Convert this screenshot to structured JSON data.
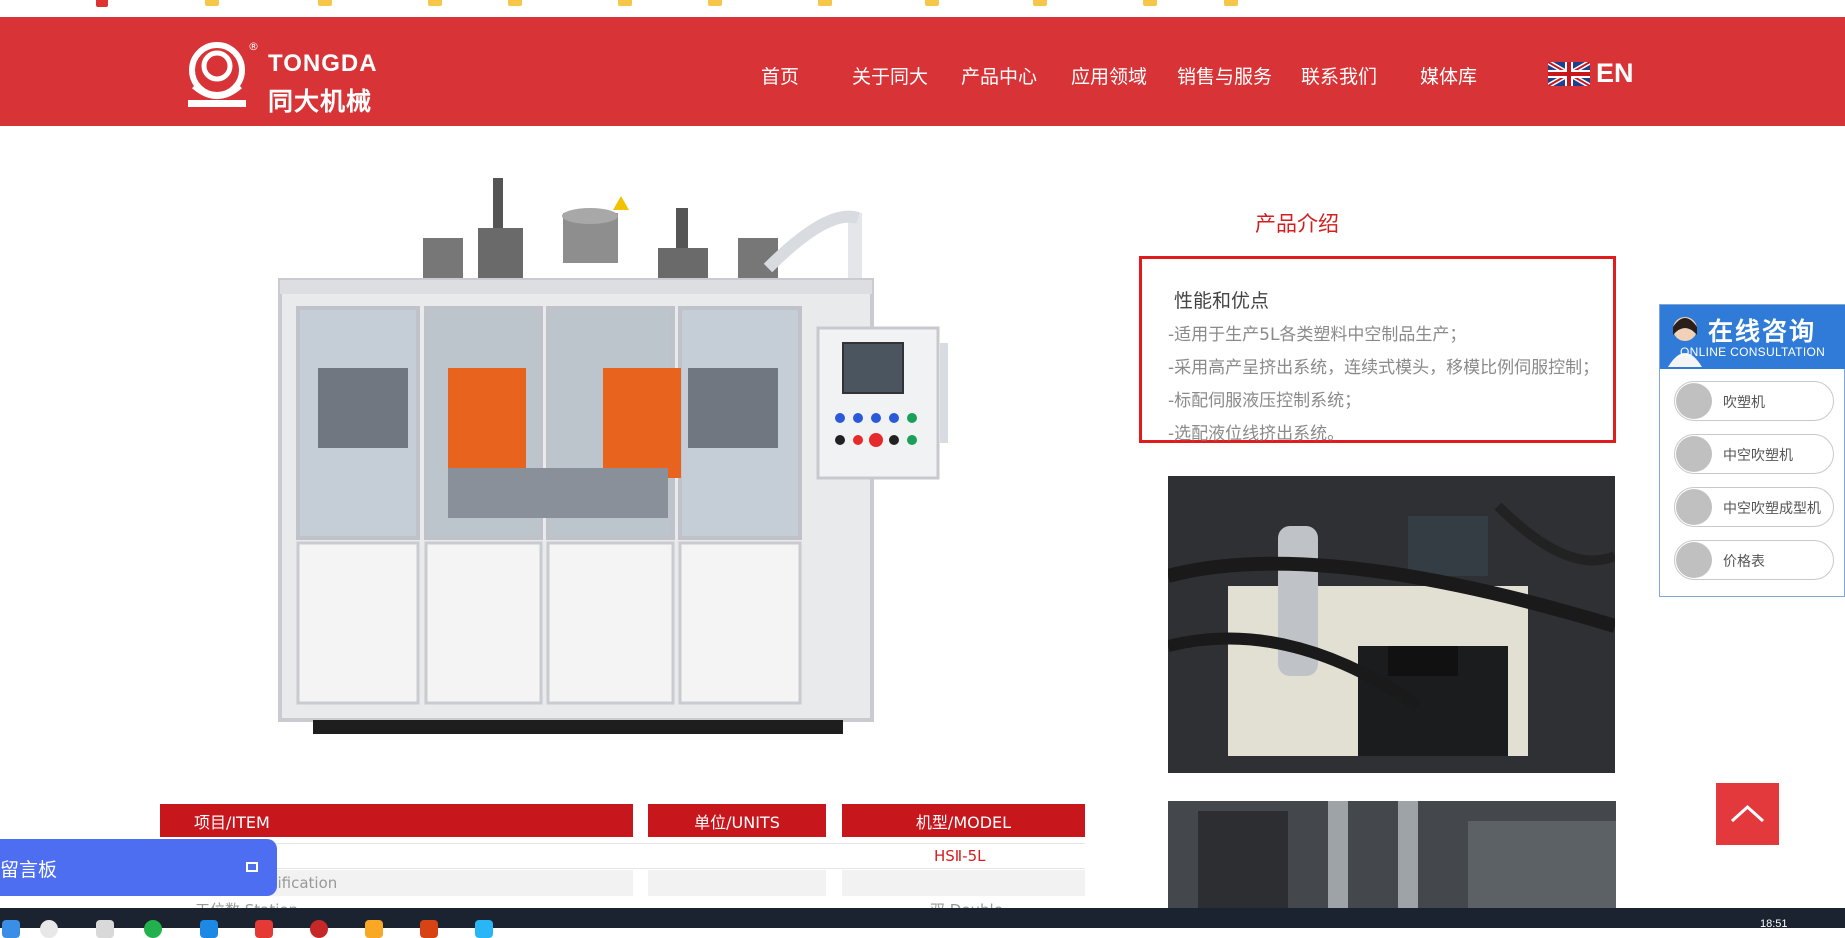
{
  "bookmarks": [
    {
      "label": "",
      "icon": "red-star-icon"
    },
    {
      "label": "",
      "icon": "folder-icon"
    },
    {
      "label": "",
      "icon": "folder-icon"
    },
    {
      "label": "",
      "icon": "folder-icon"
    },
    {
      "label": "",
      "icon": "folder-icon"
    },
    {
      "label": "",
      "icon": "folder-icon"
    },
    {
      "label": "",
      "icon": "folder-icon"
    },
    {
      "label": "",
      "icon": "folder-icon"
    },
    {
      "label": "",
      "icon": "folder-icon"
    },
    {
      "label": "",
      "icon": "folder-icon"
    },
    {
      "label": "",
      "icon": "folder-icon"
    },
    {
      "label": "",
      "icon": "folder-icon"
    }
  ],
  "header": {
    "brand_en": "TONGDA",
    "brand_cn": "同大机械",
    "reg_mark": "®",
    "nav": [
      "首页",
      "关于同大",
      "产品中心",
      "应用领域",
      "销售与服务",
      "联系我们",
      "媒体库"
    ],
    "lang": "EN",
    "colors": {
      "header_bg": "#d83336"
    }
  },
  "intro": {
    "title": "产品介绍",
    "heading": "性能和优点",
    "lines": [
      "-适用于生产5L各类塑料中空制品生产；",
      "-采用高产呈挤出系统，连续式模头，移模比例伺服控制；",
      "-标配伺服液压控制系统；",
      "-选配液位线挤出系统。"
    ]
  },
  "spec_table": {
    "headers": [
      "项目/ITEM",
      "单位/UNITS",
      "机型/MODEL"
    ],
    "rows": [
      [
        "",
        "",
        "HSⅡ-5L"
      ],
      [
        "ecification",
        "",
        ""
      ],
      [
        "工位数 Station",
        "",
        "双 Double"
      ]
    ]
  },
  "consult": {
    "title": "在线咨询",
    "subtitle": "ONLINE CONSULTATION",
    "items": [
      "吹塑机",
      "中空吹塑机",
      "中空吹塑成型机",
      "价格表"
    ]
  },
  "message_board": {
    "label": "留言板"
  },
  "taskbar": {
    "time": "18:51"
  }
}
